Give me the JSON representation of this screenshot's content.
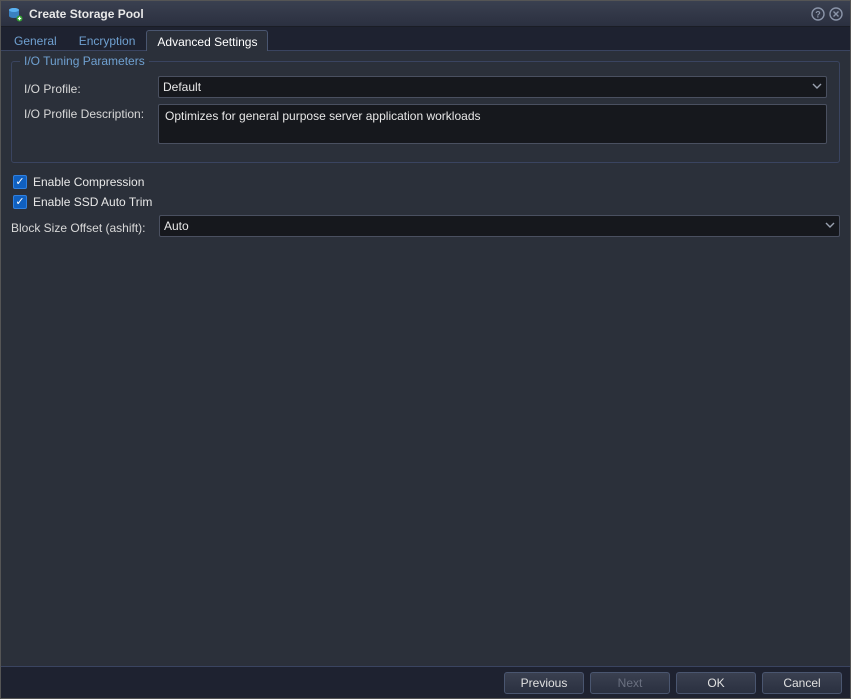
{
  "window": {
    "title": "Create Storage Pool"
  },
  "tabs": {
    "general": "General",
    "encryption": "Encryption",
    "advanced": "Advanced Settings"
  },
  "io_tuning": {
    "legend": "I/O Tuning Parameters",
    "profile_label": "I/O Profile:",
    "profile_value": "Default",
    "description_label": "I/O Profile Description:",
    "description_value": "Optimizes for general purpose server application workloads"
  },
  "options": {
    "compression_label": "Enable Compression",
    "compression_checked": true,
    "autotrim_label": "Enable SSD Auto Trim",
    "autotrim_checked": true,
    "ashift_label": "Block Size Offset (ashift):",
    "ashift_value": "Auto"
  },
  "footer": {
    "previous": "Previous",
    "next": "Next",
    "ok": "OK",
    "cancel": "Cancel"
  }
}
